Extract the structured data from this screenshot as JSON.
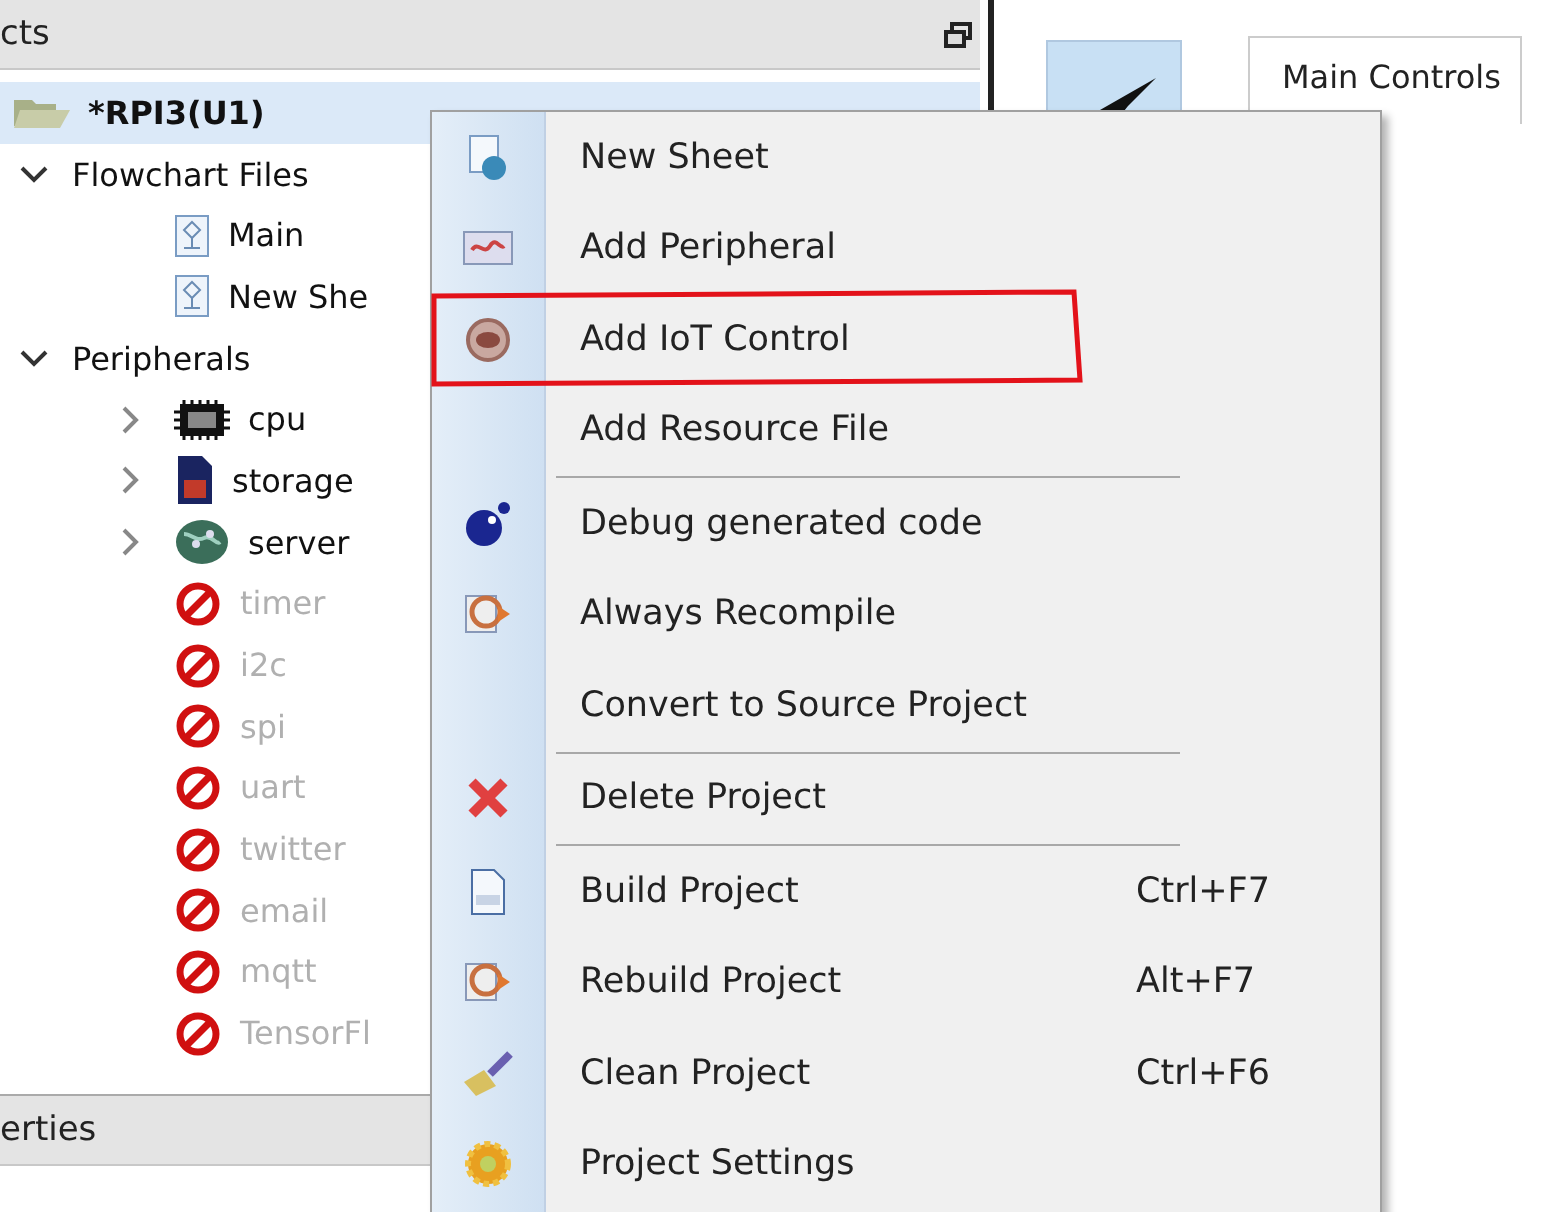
{
  "projects_panel": {
    "title": "cts"
  },
  "tree": [
    {
      "label": "*RPI3(U1)",
      "kind": "project",
      "selected": true,
      "disabled": false,
      "children": [
        {
          "label": "Flowchart Files",
          "selected": false,
          "expanded": true,
          "disabled": false,
          "children": [
            {
              "label": "Main",
              "kind": "sheet",
              "selected": false,
              "disabled": false
            },
            {
              "label": "New She",
              "kind": "sheet",
              "selected": false,
              "disabled": false
            }
          ]
        },
        {
          "label": "Peripherals",
          "selected": false,
          "expanded": true,
          "disabled": false,
          "children": [
            {
              "label": "cpu",
              "kind": "chip",
              "selected": false,
              "expanded": false,
              "disabled": false
            },
            {
              "label": "storage",
              "kind": "storage",
              "selected": false,
              "expanded": false,
              "disabled": false
            },
            {
              "label": "server",
              "kind": "globe",
              "selected": false,
              "expanded": false,
              "disabled": false
            },
            {
              "label": "timer",
              "kind": "peripheral",
              "selected": false,
              "disabled": true
            },
            {
              "label": "i2c",
              "kind": "peripheral",
              "selected": false,
              "disabled": true
            },
            {
              "label": "spi",
              "kind": "peripheral",
              "selected": false,
              "disabled": true
            },
            {
              "label": "uart",
              "kind": "peripheral",
              "selected": false,
              "disabled": true
            },
            {
              "label": "twitter",
              "kind": "peripheral",
              "selected": false,
              "disabled": true
            },
            {
              "label": "email",
              "kind": "peripheral",
              "selected": false,
              "disabled": true
            },
            {
              "label": "mqtt",
              "kind": "peripheral",
              "selected": false,
              "disabled": true
            },
            {
              "label": "TensorFl",
              "kind": "peripheral",
              "selected": false,
              "disabled": true
            }
          ]
        }
      ]
    }
  ],
  "properties_panel": {
    "title": "erties"
  },
  "editor_tab": {
    "label": "Main Controls"
  },
  "context_menu": {
    "groups": [
      [
        {
          "label": "New Sheet"
        },
        {
          "label": "Add Peripheral"
        },
        {
          "label": "Add IoT Control"
        },
        {
          "label": "Add Resource File"
        }
      ],
      [
        {
          "label": "Debug generated code"
        },
        {
          "label": "Always Recompile"
        },
        {
          "label": "Convert to Source Project"
        }
      ],
      [
        {
          "label": "Delete Project"
        }
      ],
      [
        {
          "label": "Build Project",
          "shortcut": "Ctrl+F7"
        },
        {
          "label": "Rebuild Project",
          "shortcut": "Alt+F7"
        },
        {
          "label": "Clean Project",
          "shortcut": "Ctrl+F6"
        },
        {
          "label": "Project Settings"
        }
      ]
    ]
  }
}
